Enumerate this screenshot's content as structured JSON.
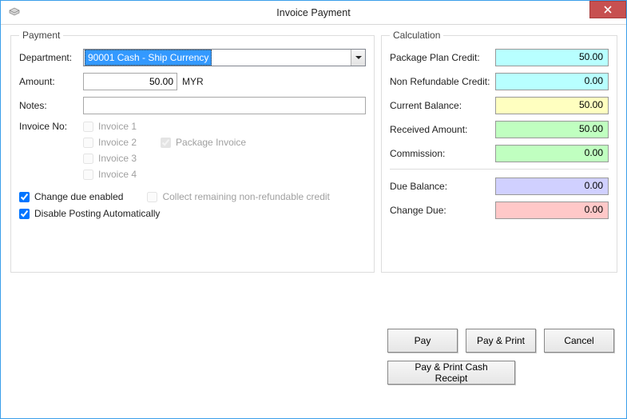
{
  "window": {
    "title": "Invoice Payment",
    "close_tooltip": "Close"
  },
  "payment": {
    "legend": "Payment",
    "department_label": "Department:",
    "department_value": "90001  Cash - Ship Currency",
    "amount_label": "Amount:",
    "amount_value": "50.00",
    "currency": "MYR",
    "notes_label": "Notes:",
    "notes_value": "",
    "invoice_no_label": "Invoice No:",
    "invoices": [
      "Invoice 1",
      "Invoice 2",
      "Invoice 3",
      "Invoice 4"
    ],
    "package_invoice_label": "Package Invoice",
    "change_due_enabled_label": "Change due enabled",
    "collect_remaining_label": "Collect remaining non-refundable credit",
    "disable_posting_label": "Disable Posting Automatically"
  },
  "calculation": {
    "legend": "Calculation",
    "rows": {
      "package_plan_credit": {
        "label": "Package Plan Credit:",
        "value": "50.00"
      },
      "non_refundable_credit": {
        "label": "Non Refundable Credit:",
        "value": "0.00"
      },
      "current_balance": {
        "label": "Current Balance:",
        "value": "50.00"
      },
      "received_amount": {
        "label": "Received Amount:",
        "value": "50.00"
      },
      "commission": {
        "label": "Commission:",
        "value": "0.00"
      },
      "due_balance": {
        "label": "Due Balance:",
        "value": "0.00"
      },
      "change_due": {
        "label": "Change Due:",
        "value": "0.00"
      }
    }
  },
  "buttons": {
    "pay": "Pay",
    "pay_print": "Pay & Print",
    "cancel": "Cancel",
    "pay_print_cash": "Pay & Print Cash Receipt"
  }
}
